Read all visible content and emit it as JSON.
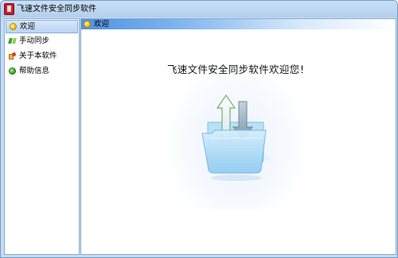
{
  "window": {
    "title": "飞速文件安全同步软件"
  },
  "sidebar": {
    "items": [
      {
        "label": "欢迎",
        "icon": "sun-icon",
        "selected": true
      },
      {
        "label": "手动同步",
        "icon": "sync-icon",
        "selected": false
      },
      {
        "label": "关于本软件",
        "icon": "about-icon",
        "selected": false
      },
      {
        "label": "帮助信息",
        "icon": "help-icon",
        "selected": false
      }
    ]
  },
  "content": {
    "header_label": "欢迎",
    "header_icon": "sun-icon",
    "welcome_message": "飞速文件安全同步软件欢迎您！",
    "illustration": "folder-upload-download-icon"
  },
  "colors": {
    "title_bar": "#b3cfee",
    "header_gradient_start": "#4f92e0",
    "folder_blue": "#9fd3f3",
    "arrow_gray": "#8aa6b6"
  }
}
